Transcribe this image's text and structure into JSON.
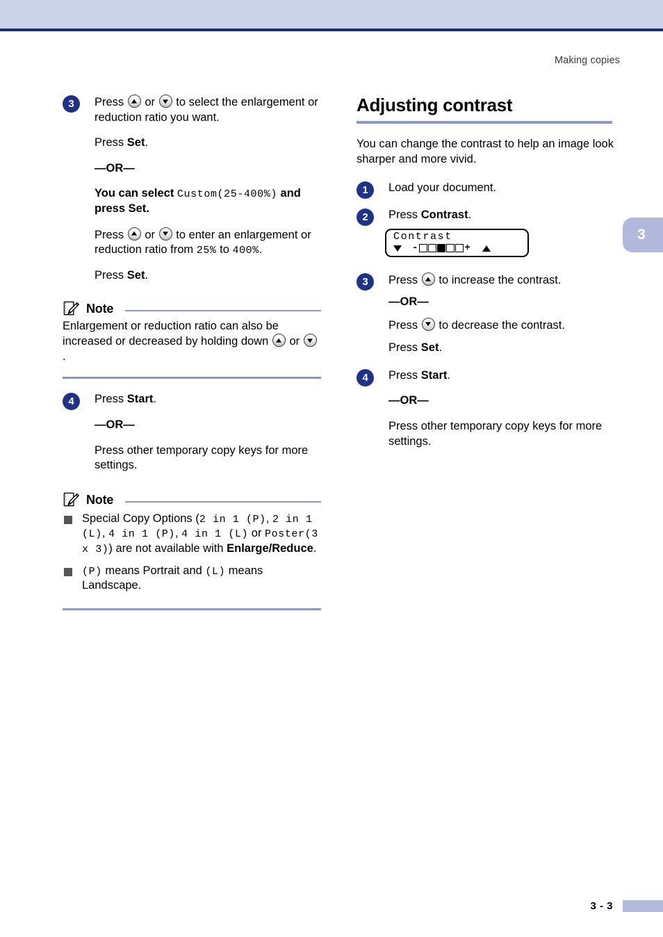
{
  "page": {
    "running_head": "Making copies",
    "chapter_tab": "3",
    "footer_page": "3 - 3",
    "accent_color": "#8c97c5",
    "badge_color": "#1f3287",
    "banner_color": "#ccd2e8",
    "banner_rule_color": "#1a2a7d"
  },
  "left_column": {
    "step3": {
      "number": "3",
      "line1_a": "Press",
      "line1_b": "or",
      "line1_c": "to select the enlargement or reduction ratio you want.",
      "press_set_a": "Press ",
      "set_label": "Set",
      "period": ".",
      "or": "—OR—",
      "custom_a": "You can select ",
      "custom_mono": "Custom(25-400%)",
      "custom_b": " and press ",
      "custom_set": "Set",
      "custom_period": ".",
      "ratio_a": "Press",
      "ratio_or": "or",
      "ratio_b": "to enter an enlargement or reduction ratio from ",
      "ratio_min": "25%",
      "ratio_to": " to ",
      "ratio_max": "400%",
      "ratio_period": ".",
      "press_set2_a": "Press ",
      "set_label2": "Set",
      "period2": "."
    },
    "note1": {
      "title": "Note",
      "text_a": "Enlargement or reduction ratio can also be increased or decreased by holding down",
      "text_b": "or",
      "text_c": "."
    },
    "step4": {
      "number": "4",
      "press_a": "Press ",
      "start_label": "Start",
      "period": ".",
      "or": "—OR—",
      "other": "Press other temporary copy keys for more settings."
    },
    "note2": {
      "title": "Note",
      "bullet1_a": "Special Copy Options",
      "bullet1_paren_open": " (",
      "bullet1_mono1": "2 in 1 (P)",
      "bullet1_comma1": ", ",
      "bullet1_mono2": "2 in 1 (L)",
      "bullet1_comma2": ", ",
      "bullet1_mono3": "4 in 1 (P)",
      "bullet1_comma3": ", ",
      "bullet1_mono4": "4 in 1 (L)",
      "bullet1_or": " or ",
      "bullet1_mono5": "Poster(3 x 3)",
      "bullet1_paren_close": ") ",
      "bullet1_tail": "are not available with ",
      "bullet1_bold": "Enlarge/Reduce",
      "bullet1_period": ".",
      "bullet2_mono1": "(P)",
      "bullet2_mid": " means Portrait and ",
      "bullet2_mono2": "(L)",
      "bullet2_tail": " means Landscape."
    }
  },
  "right_column": {
    "section_title": "Adjusting contrast",
    "intro": "You can change the contrast to help an image look sharper and more vivid.",
    "step1": {
      "number": "1",
      "text": "Load your document."
    },
    "step2": {
      "number": "2",
      "press_a": "Press ",
      "contrast_label": "Contrast",
      "period": "."
    },
    "lcd": {
      "line1": "Contrast",
      "left_arrow": "▼",
      "minus": "-",
      "plus": "+",
      "right_arrow": "▲",
      "gauge_total": 5,
      "gauge_filled_index": 2
    },
    "step3": {
      "number": "3",
      "press_a": "Press",
      "increase": "to increase the contrast.",
      "or": "—OR—",
      "press_b": "Press",
      "decrease": "to decrease the contrast.",
      "press_set": "Press ",
      "set_label": "Set",
      "period": "."
    },
    "step4": {
      "number": "4",
      "press_a": "Press ",
      "start_label": "Start",
      "period": ".",
      "or": "—OR—",
      "other": "Press other temporary copy keys for more settings."
    }
  }
}
